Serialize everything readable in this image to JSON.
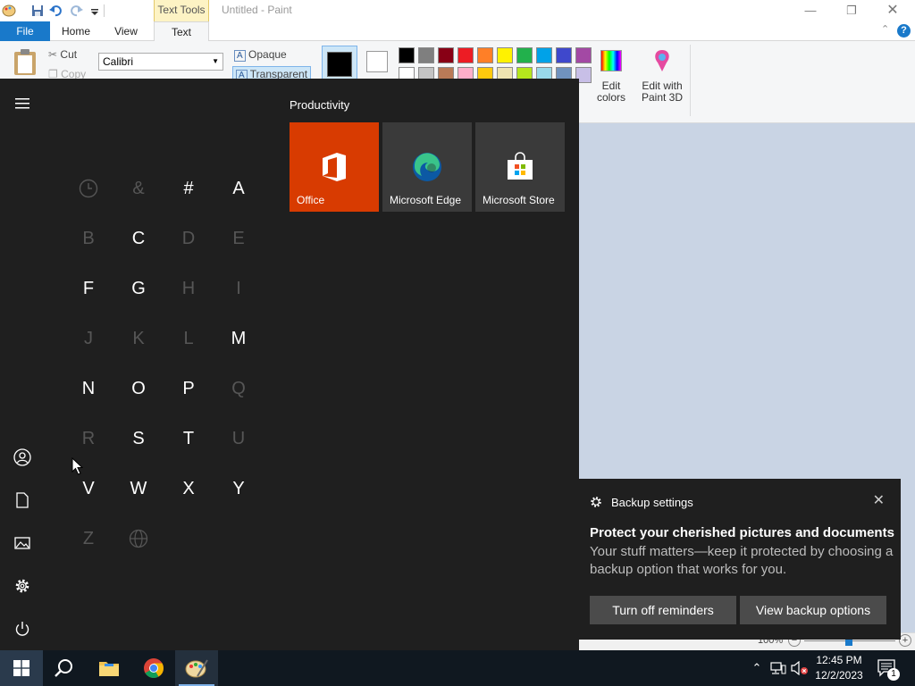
{
  "paint": {
    "title": "Untitled - Paint",
    "contextual_tab": "Text Tools",
    "tabs": [
      "File",
      "Home",
      "View",
      "Text"
    ],
    "clipboard": {
      "cut": "Cut",
      "copy": "Copy"
    },
    "font_name": "Calibri",
    "background": {
      "opaque": "Opaque",
      "transparent": "Transparent"
    },
    "edit_colors": "Edit\ncolors",
    "edit_paint3d": "Edit with\nPaint 3D",
    "zoom": "100%",
    "palette": [
      "#000000",
      "#7f7f7f",
      "#880015",
      "#ed1c24",
      "#ff7f27",
      "#fff200",
      "#22b14c",
      "#00a2e8",
      "#3f48cc",
      "#a349a4"
    ],
    "palette_row2": [
      "#ffffff",
      "#c3c3c3",
      "#b97a57",
      "#ffaec9",
      "#ffc90e",
      "#efe4b0",
      "#b5e61d",
      "#99d9ea",
      "#7092be",
      "#c8bfe7"
    ]
  },
  "start_menu": {
    "group_title": "Productivity",
    "tiles": [
      {
        "label": "Office",
        "color": "#d83b01"
      },
      {
        "label": "Microsoft Edge",
        "color": "#3a3a3a"
      },
      {
        "label": "Microsoft Store",
        "color": "#3a3a3a"
      }
    ],
    "letters": [
      {
        "char": "clock-icon",
        "enabled": false
      },
      {
        "char": "&",
        "enabled": false
      },
      {
        "char": "#",
        "enabled": true
      },
      {
        "char": "A",
        "enabled": true
      },
      {
        "char": "B",
        "enabled": false
      },
      {
        "char": "C",
        "enabled": true
      },
      {
        "char": "D",
        "enabled": false
      },
      {
        "char": "E",
        "enabled": false
      },
      {
        "char": "F",
        "enabled": true
      },
      {
        "char": "G",
        "enabled": true
      },
      {
        "char": "H",
        "enabled": false
      },
      {
        "char": "I",
        "enabled": false
      },
      {
        "char": "J",
        "enabled": false
      },
      {
        "char": "K",
        "enabled": false
      },
      {
        "char": "L",
        "enabled": false
      },
      {
        "char": "M",
        "enabled": true
      },
      {
        "char": "N",
        "enabled": true
      },
      {
        "char": "O",
        "enabled": true
      },
      {
        "char": "P",
        "enabled": true
      },
      {
        "char": "Q",
        "enabled": false
      },
      {
        "char": "R",
        "enabled": false
      },
      {
        "char": "S",
        "enabled": true
      },
      {
        "char": "T",
        "enabled": true
      },
      {
        "char": "U",
        "enabled": false
      },
      {
        "char": "V",
        "enabled": true
      },
      {
        "char": "W",
        "enabled": true
      },
      {
        "char": "X",
        "enabled": true
      },
      {
        "char": "Y",
        "enabled": true
      },
      {
        "char": "Z",
        "enabled": false
      },
      {
        "char": "globe-icon",
        "enabled": false
      }
    ]
  },
  "notification": {
    "app": "Backup settings",
    "title": "Protect your cherished pictures and documents",
    "body": "Your stuff matters—keep it protected by choosing a backup option that works for you.",
    "button_left": "Turn off reminders",
    "button_right": "View backup options"
  },
  "taskbar": {
    "time": "12:45 PM",
    "date": "12/2/2023",
    "notification_count": "1"
  }
}
